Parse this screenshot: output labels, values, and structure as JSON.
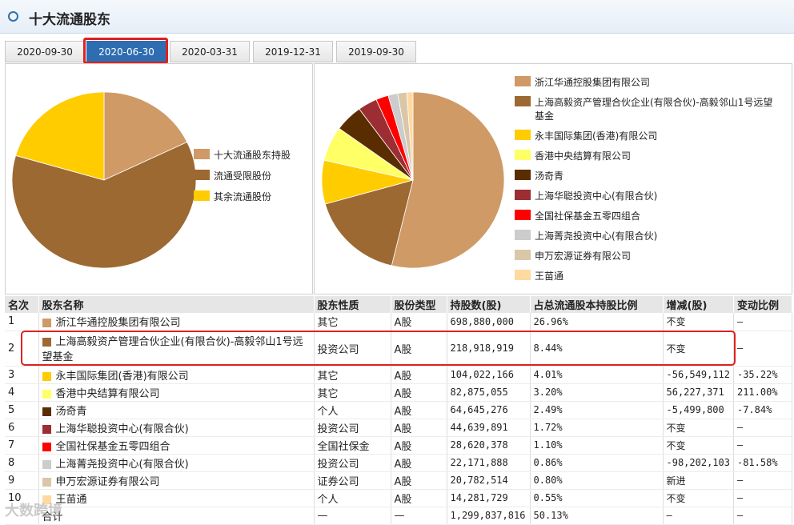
{
  "header": {
    "title": "十大流通股东"
  },
  "tabs": [
    {
      "label": "2020-09-30",
      "active": false
    },
    {
      "label": "2020-06-30",
      "active": true
    },
    {
      "label": "2020-03-31",
      "active": false
    },
    {
      "label": "2019-12-31",
      "active": false
    },
    {
      "label": "2019-09-30",
      "active": false
    }
  ],
  "chart_data": [
    {
      "type": "pie",
      "labels": [
        "十大流通股东持股",
        "流通受限股份",
        "其余流通股份"
      ],
      "values": [
        17.9,
        61.6,
        20.5
      ],
      "colors": [
        "#cf9a66",
        "#9c6933",
        "#ffcc00"
      ]
    },
    {
      "type": "pie",
      "labels": [
        "浙江华通控股集团有限公司",
        "上海高毅资产管理合伙企业(有限合伙)-高毅邻山1号远望基金",
        "永丰国际集团(香港)有限公司",
        "香港中央结算有限公司",
        "汤奇青",
        "上海华聪投资中心(有限合伙)",
        "全国社保基金五零四组合",
        "上海菁尧投资中心(有限合伙)",
        "申万宏源证券有限公司",
        "王苗通"
      ],
      "values": [
        698880000,
        218918919,
        104022166,
        82875055,
        64645276,
        44639891,
        28620378,
        22171888,
        20782514,
        14281729
      ],
      "colors": [
        "#cf9a66",
        "#9c6933",
        "#ffcc00",
        "#ffff66",
        "#5a2d00",
        "#9c2e33",
        "#ff0000",
        "#cccccc",
        "#d9c7a8",
        "#ffd9a0"
      ]
    }
  ],
  "table": {
    "headers": [
      "名次",
      "股东名称",
      "股东性质",
      "股份类型",
      "持股数(股)",
      "占总流通股本持股比例",
      "增减(股)",
      "变动比例"
    ],
    "rows": [
      {
        "rank": "1",
        "name": "浙江华通控股集团有限公司",
        "nature": "其它",
        "type": "A股",
        "shares": "698,880,000",
        "ratio": "26.96%",
        "change": "不变",
        "change_ratio": "—",
        "color": "#cf9a66"
      },
      {
        "rank": "2",
        "name": "上海高毅资产管理合伙企业(有限合伙)-高毅邻山1号远望基金",
        "nature": "投资公司",
        "type": "A股",
        "shares": "218,918,919",
        "ratio": "8.44%",
        "change": "不变",
        "change_ratio": "—",
        "color": "#9c6933"
      },
      {
        "rank": "3",
        "name": "永丰国际集团(香港)有限公司",
        "nature": "其它",
        "type": "A股",
        "shares": "104,022,166",
        "ratio": "4.01%",
        "change": "-56,549,112",
        "change_ratio": "-35.22%",
        "color": "#ffcc00"
      },
      {
        "rank": "4",
        "name": "香港中央结算有限公司",
        "nature": "其它",
        "type": "A股",
        "shares": "82,875,055",
        "ratio": "3.20%",
        "change": "56,227,371",
        "change_ratio": "211.00%",
        "color": "#ffff66"
      },
      {
        "rank": "5",
        "name": "汤奇青",
        "nature": "个人",
        "type": "A股",
        "shares": "64,645,276",
        "ratio": "2.49%",
        "change": "-5,499,800",
        "change_ratio": "-7.84%",
        "color": "#5a2d00"
      },
      {
        "rank": "6",
        "name": "上海华聪投资中心(有限合伙)",
        "nature": "投资公司",
        "type": "A股",
        "shares": "44,639,891",
        "ratio": "1.72%",
        "change": "不变",
        "change_ratio": "—",
        "color": "#9c2e33"
      },
      {
        "rank": "7",
        "name": "全国社保基金五零四组合",
        "nature": "全国社保金",
        "type": "A股",
        "shares": "28,620,378",
        "ratio": "1.10%",
        "change": "不变",
        "change_ratio": "—",
        "color": "#ff0000"
      },
      {
        "rank": "8",
        "name": "上海菁尧投资中心(有限合伙)",
        "nature": "投资公司",
        "type": "A股",
        "shares": "22,171,888",
        "ratio": "0.86%",
        "change": "-98,202,103",
        "change_ratio": "-81.58%",
        "color": "#cccccc"
      },
      {
        "rank": "9",
        "name": "申万宏源证券有限公司",
        "nature": "证券公司",
        "type": "A股",
        "shares": "20,782,514",
        "ratio": "0.80%",
        "change": "新进",
        "change_ratio": "—",
        "color": "#d9c7a8"
      },
      {
        "rank": "10",
        "name": "王苗通",
        "nature": "个人",
        "type": "A股",
        "shares": "14,281,729",
        "ratio": "0.55%",
        "change": "不变",
        "change_ratio": "—",
        "color": "#ffd9a0"
      }
    ],
    "total": {
      "label": "合计",
      "nature": "—",
      "type": "—",
      "shares": "1,299,837,816",
      "ratio": "50.13%",
      "change": "—",
      "change_ratio": "—"
    }
  },
  "watermark": "大数跨境"
}
